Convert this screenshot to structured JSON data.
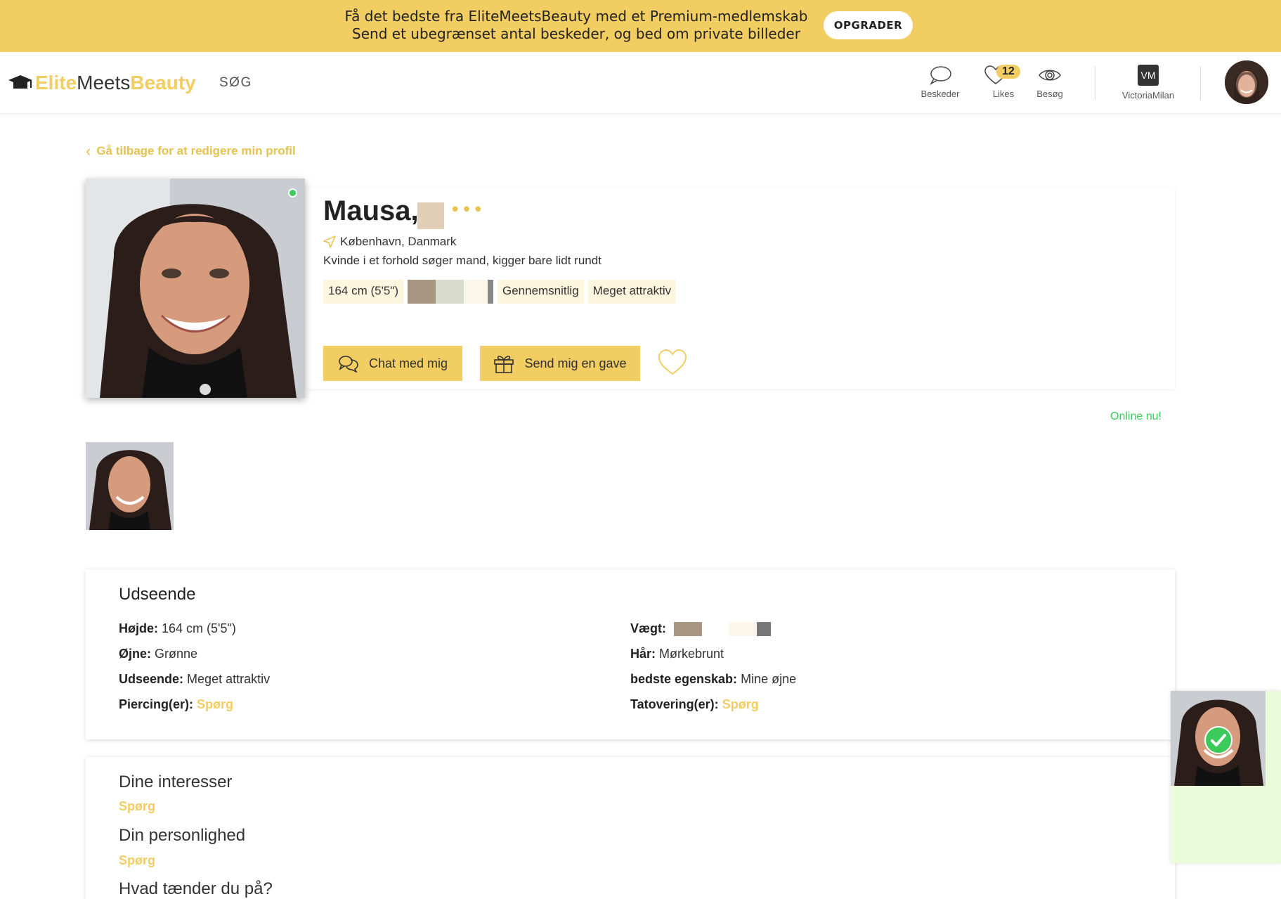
{
  "banner": {
    "line1": "Få det bedste fra EliteMeetsBeauty med et Premium-medlemskab",
    "line2": "Send et ubegrænset antal beskeder, og bed om private billeder",
    "upgrade_label": "OPGRADER"
  },
  "header": {
    "logo": {
      "elite": "Elite",
      "meets": "Meets",
      "beauty": "Beauty"
    },
    "search_label": "SØG",
    "messages_label": "Beskeder",
    "likes_label": "Likes",
    "likes_count": "12",
    "visits_label": "Besøg",
    "vm_initials": "VM",
    "vm_label": "VictoriaMilan"
  },
  "back_link": "Gå tilbage for at redigere min profil",
  "profile": {
    "name": "Mausa,",
    "more": "•••",
    "location": "København, Danmark",
    "tagline": "Kvinde i et forhold søger mand, kigger bare lidt rundt",
    "chips": [
      "164 cm (5'5\")",
      "Gennemsnitlig",
      "Meget attraktiv"
    ],
    "chat_label": "Chat med mig",
    "gift_label": "Send mig en gave",
    "online_now": "Online nu!"
  },
  "appearance": {
    "title": "Udseende",
    "height_label": "Højde:",
    "height_value": "164 cm (5'5\")",
    "eyes_label": "Øjne:",
    "eyes_value": "Grønne",
    "looks_label": "Udseende:",
    "looks_value": "Meget attraktiv",
    "piercing_label": "Piercing(er):",
    "piercing_value": "Spørg",
    "weight_label": "Vægt:",
    "hair_label": "Hår:",
    "hair_value": "Mørkebrunt",
    "best_label": "bedste egenskab:",
    "best_value": "Mine øjne",
    "tattoo_label": "Tatovering(er):",
    "tattoo_value": "Spørg"
  },
  "interests": {
    "q1": "Dine interesser",
    "a1": "Spørg",
    "q2": "Din personlighed",
    "a2": "Spørg",
    "q3": "Hvad tænder du på?"
  },
  "colors": {
    "accent": "#f2cd62",
    "online": "#3ccb5a"
  }
}
